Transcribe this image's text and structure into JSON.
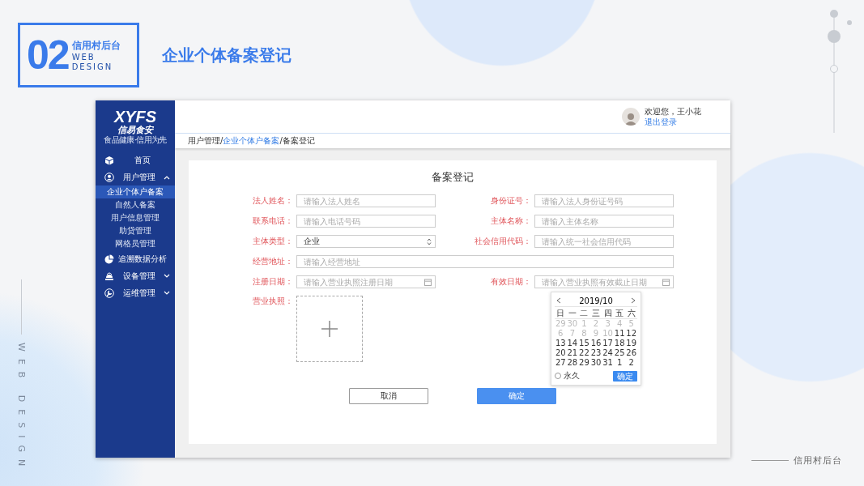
{
  "slide": {
    "badge_number": "02",
    "badge_title": "信用村后台",
    "badge_lines": [
      "WEB",
      "DESIGN"
    ],
    "title": "企业个体备案登记",
    "side_text": "WEB DESIGN",
    "footer": "信用村后台"
  },
  "app": {
    "sidebar": {
      "logo": "XYFS",
      "logo_name": "信易食安",
      "logo_tagline": "食品健康·信用为先",
      "menu": [
        {
          "label": "首页",
          "kind": "link"
        },
        {
          "label": "用户管理",
          "kind": "group",
          "expanded": true,
          "children": [
            {
              "label": "企业个体户备案",
              "selected": true
            },
            {
              "label": "自然人备案",
              "selected": false
            },
            {
              "label": "用户信息管理",
              "selected": false
            },
            {
              "label": "助贷管理",
              "selected": false
            },
            {
              "label": "网格员管理",
              "selected": false
            }
          ]
        },
        {
          "label": "追溯数据分析",
          "kind": "link"
        },
        {
          "label": "设备管理",
          "kind": "group",
          "expanded": false
        },
        {
          "label": "运维管理",
          "kind": "group",
          "expanded": false
        }
      ]
    },
    "topbar": {
      "greeting": "欢迎您，王小花",
      "logout": "退出登录"
    },
    "breadcrumb": [
      {
        "label": "用户管理/",
        "kind": "text"
      },
      {
        "label": "企业个体户备案",
        "kind": "link"
      },
      {
        "label": "/备案登记",
        "kind": "text"
      }
    ],
    "form": {
      "title": "备案登记",
      "fields": [
        {
          "label": "法人姓名：",
          "kind": "text",
          "placeholder": "请输入法人姓名"
        },
        {
          "label": "身份证号：",
          "kind": "text",
          "placeholder": "请输入法人身份证号码"
        },
        {
          "label": "联系电话：",
          "kind": "text",
          "placeholder": "请输入电话号码"
        },
        {
          "label": "主体名称：",
          "kind": "text",
          "placeholder": "请输入主体名称"
        },
        {
          "label": "主体类型：",
          "kind": "select",
          "value": "企业"
        },
        {
          "label": "社会信用代码：",
          "kind": "text",
          "placeholder": "请输入统一社会信用代码"
        },
        {
          "label": "经营地址：",
          "kind": "wide",
          "placeholder": "请输入经营地址"
        },
        {
          "label": "注册日期：",
          "kind": "date",
          "placeholder": "请输入营业执照注册日期"
        },
        {
          "label": "有效日期：",
          "kind": "date",
          "placeholder": "请输入营业执照有效截止日期",
          "calendar": {
            "month": "2019/10",
            "weekdays": [
              "日",
              "一",
              "二",
              "三",
              "四",
              "五",
              "六"
            ],
            "days": [
              {
                "label": "29",
                "muted": true
              },
              {
                "label": "30",
                "muted": true
              },
              {
                "label": "1",
                "muted": true
              },
              {
                "label": "2",
                "muted": true
              },
              {
                "label": "3",
                "muted": true
              },
              {
                "label": "4",
                "muted": true
              },
              {
                "label": "5",
                "muted": true
              },
              {
                "label": "6",
                "muted": true
              },
              {
                "label": "7",
                "muted": true
              },
              {
                "label": "8",
                "muted": true
              },
              {
                "label": "9",
                "muted": true
              },
              {
                "label": "10",
                "muted": true
              },
              {
                "label": "11",
                "muted": false
              },
              {
                "label": "12",
                "muted": false
              },
              {
                "label": "13",
                "muted": false
              },
              {
                "label": "14",
                "muted": false
              },
              {
                "label": "15",
                "muted": false
              },
              {
                "label": "16",
                "muted": false
              },
              {
                "label": "17",
                "muted": false
              },
              {
                "label": "18",
                "muted": false
              },
              {
                "label": "19",
                "muted": false
              },
              {
                "label": "20",
                "muted": false
              },
              {
                "label": "21",
                "muted": false
              },
              {
                "label": "22",
                "muted": false
              },
              {
                "label": "23",
                "muted": false
              },
              {
                "label": "24",
                "muted": false
              },
              {
                "label": "25",
                "muted": false
              },
              {
                "label": "26",
                "muted": false
              },
              {
                "label": "27",
                "muted": false
              },
              {
                "label": "28",
                "muted": false
              },
              {
                "label": "29",
                "muted": false
              },
              {
                "label": "30",
                "muted": false
              },
              {
                "label": "31",
                "muted": false
              },
              {
                "label": "1",
                "muted": false
              },
              {
                "label": "2",
                "muted": false
              }
            ],
            "permanent": {
              "label": "永久",
              "checked": false
            },
            "confirm": "确定"
          }
        }
      ],
      "upload": {
        "label": "营业执照："
      },
      "buttons": [
        {
          "label": "取消",
          "kind": "secondary"
        },
        {
          "label": "确定",
          "kind": "primary"
        }
      ]
    }
  }
}
